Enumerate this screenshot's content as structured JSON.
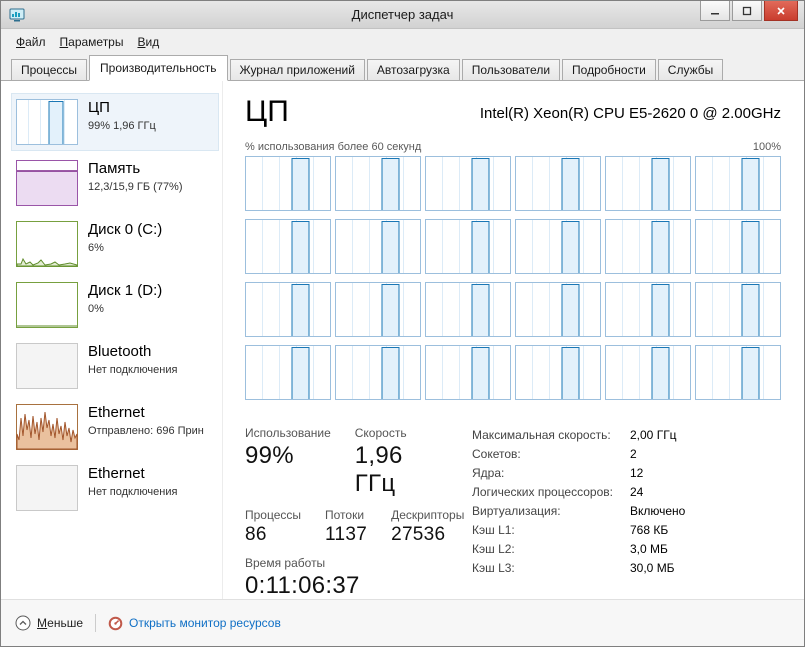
{
  "window": {
    "title": "Диспетчер задач"
  },
  "menu": {
    "items": [
      {
        "label": "Файл",
        "slug": "file"
      },
      {
        "label": "Параметры",
        "slug": "options"
      },
      {
        "label": "Вид",
        "slug": "view"
      }
    ]
  },
  "tabs": {
    "items": [
      {
        "label": "Процессы",
        "slug": "processes"
      },
      {
        "label": "Производительность",
        "slug": "performance"
      },
      {
        "label": "Журнал приложений",
        "slug": "app-history"
      },
      {
        "label": "Автозагрузка",
        "slug": "startup"
      },
      {
        "label": "Пользователи",
        "slug": "users"
      },
      {
        "label": "Подробности",
        "slug": "details"
      },
      {
        "label": "Службы",
        "slug": "services"
      }
    ],
    "active_slug": "performance"
  },
  "sidebar": {
    "items": [
      {
        "id": "cpu",
        "name": "ЦП",
        "detail": "99% 1,96 ГГц",
        "chart": "cpu",
        "selected": true
      },
      {
        "id": "memory",
        "name": "Память",
        "detail": "12,3/15,9 ГБ (77%)",
        "chart": "memory",
        "selected": false
      },
      {
        "id": "disk0",
        "name": "Диск 0 (C:)",
        "detail": "6%",
        "chart": "disk-active",
        "selected": false
      },
      {
        "id": "disk1",
        "name": "Диск 1 (D:)",
        "detail": "0%",
        "chart": "disk-idle",
        "selected": false
      },
      {
        "id": "bluetooth",
        "name": "Bluetooth",
        "detail": "Нет подключения",
        "chart": "idle",
        "selected": false
      },
      {
        "id": "ethernet-1",
        "name": "Ethernet",
        "detail": "Отправлено: 696 Прин",
        "chart": "network",
        "selected": false
      },
      {
        "id": "ethernet-2",
        "name": "Ethernet",
        "detail": "Нет подключения",
        "chart": "idle",
        "selected": false
      }
    ]
  },
  "main": {
    "title": "ЦП",
    "subtitle": "Intel(R) Xeon(R) CPU E5-2620 0 @ 2.00GHz",
    "chart_caption": "% использования более 60 секунд",
    "chart_scale_max": "100%",
    "core_count": 24,
    "core_columns": 6,
    "stats_rows": [
      [
        {
          "slug": "usage",
          "label": "Использование",
          "value": "99%",
          "size": "lg"
        },
        {
          "slug": "speed",
          "label": "Скорость",
          "value": "1,96 ГГц",
          "size": "lg"
        }
      ],
      [
        {
          "slug": "processes",
          "label": "Процессы",
          "value": "86",
          "size": "md"
        },
        {
          "slug": "threads",
          "label": "Потоки",
          "value": "1137",
          "size": "md"
        },
        {
          "slug": "handles",
          "label": "Дескрипторы",
          "value": "27536",
          "size": "md"
        }
      ],
      [
        {
          "slug": "uptime",
          "label": "Время работы",
          "value": "0:11:06:37",
          "size": "lg"
        }
      ]
    ],
    "specs": [
      {
        "slug": "max-speed",
        "label": "Максимальная скорость:",
        "value": "2,00 ГГц"
      },
      {
        "slug": "sockets",
        "label": "Сокетов:",
        "value": "2"
      },
      {
        "slug": "cores",
        "label": "Ядра:",
        "value": "12"
      },
      {
        "slug": "logical-processors",
        "label": "Логических процессоров:",
        "value": "24"
      },
      {
        "slug": "virtualization",
        "label": "Виртуализация:",
        "value": "Включено"
      },
      {
        "slug": "l1-cache",
        "label": "Кэш L1:",
        "value": "768 КБ"
      },
      {
        "slug": "l2-cache",
        "label": "Кэш L2:",
        "value": "3,0 МБ"
      },
      {
        "slug": "l3-cache",
        "label": "Кэш L3:",
        "value": "30,0 МБ"
      }
    ]
  },
  "footer": {
    "collapse_label": "Меньше",
    "resource_monitor_label": "Открыть монитор ресурсов"
  },
  "icons": {
    "app": "task-manager-monitor",
    "minimize": "horizontal-line",
    "maximize": "square-outline",
    "close": "x-cross",
    "collapse": "chevron-up-in-circle",
    "resource_monitor": "gauge"
  },
  "colors": {
    "cpu_accent": "#1a77b5",
    "cpu_grid": "#dcebf7",
    "cpu_fill": "#e3f1fb",
    "cpu_border": "#9cbfdd",
    "memory_accent": "#7b2588",
    "memory_fill": "#ecdcf2",
    "memory_border": "#9a55a8",
    "disk_accent": "#5f8c2a",
    "disk_fill": "#e3edd3",
    "disk_border": "#77a03f",
    "network_accent": "#a2552b",
    "network_fill": "#eac19e",
    "network_border": "#a8713f",
    "idle_border": "#c9c9c9",
    "idle_fill": "#f4f4f4",
    "link": "#0f6fc5",
    "close_button": "#c93d2e"
  }
}
